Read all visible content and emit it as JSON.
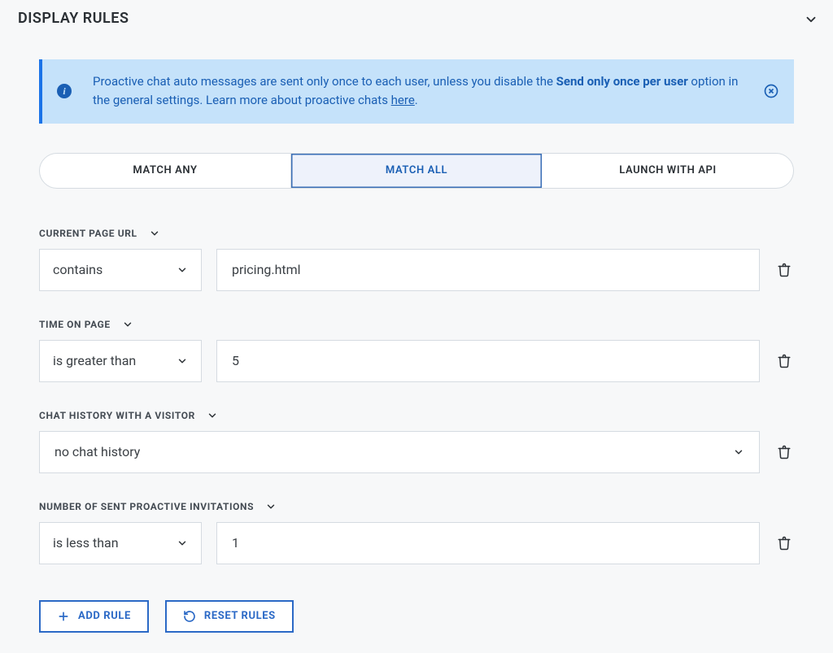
{
  "header": {
    "title": "DISPLAY RULES"
  },
  "info": {
    "text_before": "Proactive chat auto messages are sent only once to each user, unless you disable the ",
    "text_bold": "Send only once per user",
    "text_mid": " option in the general settings. Learn more about proactive chats ",
    "link_text": "here",
    "text_after": "."
  },
  "tabs": {
    "match_any": "MATCH ANY",
    "match_all": "MATCH ALL",
    "launch_api": "LAUNCH WITH API"
  },
  "rules": {
    "r1": {
      "label": "CURRENT PAGE URL",
      "operator": "contains",
      "value": "pricing.html"
    },
    "r2": {
      "label": "TIME ON PAGE",
      "operator": "is greater than",
      "value": "5"
    },
    "r3": {
      "label": "CHAT HISTORY WITH A VISITOR",
      "value": "no chat history"
    },
    "r4": {
      "label": "NUMBER OF SENT PROACTIVE INVITATIONS",
      "operator": "is less than",
      "value": "1"
    }
  },
  "actions": {
    "add_rule": "ADD RULE",
    "reset_rules": "RESET RULES"
  }
}
